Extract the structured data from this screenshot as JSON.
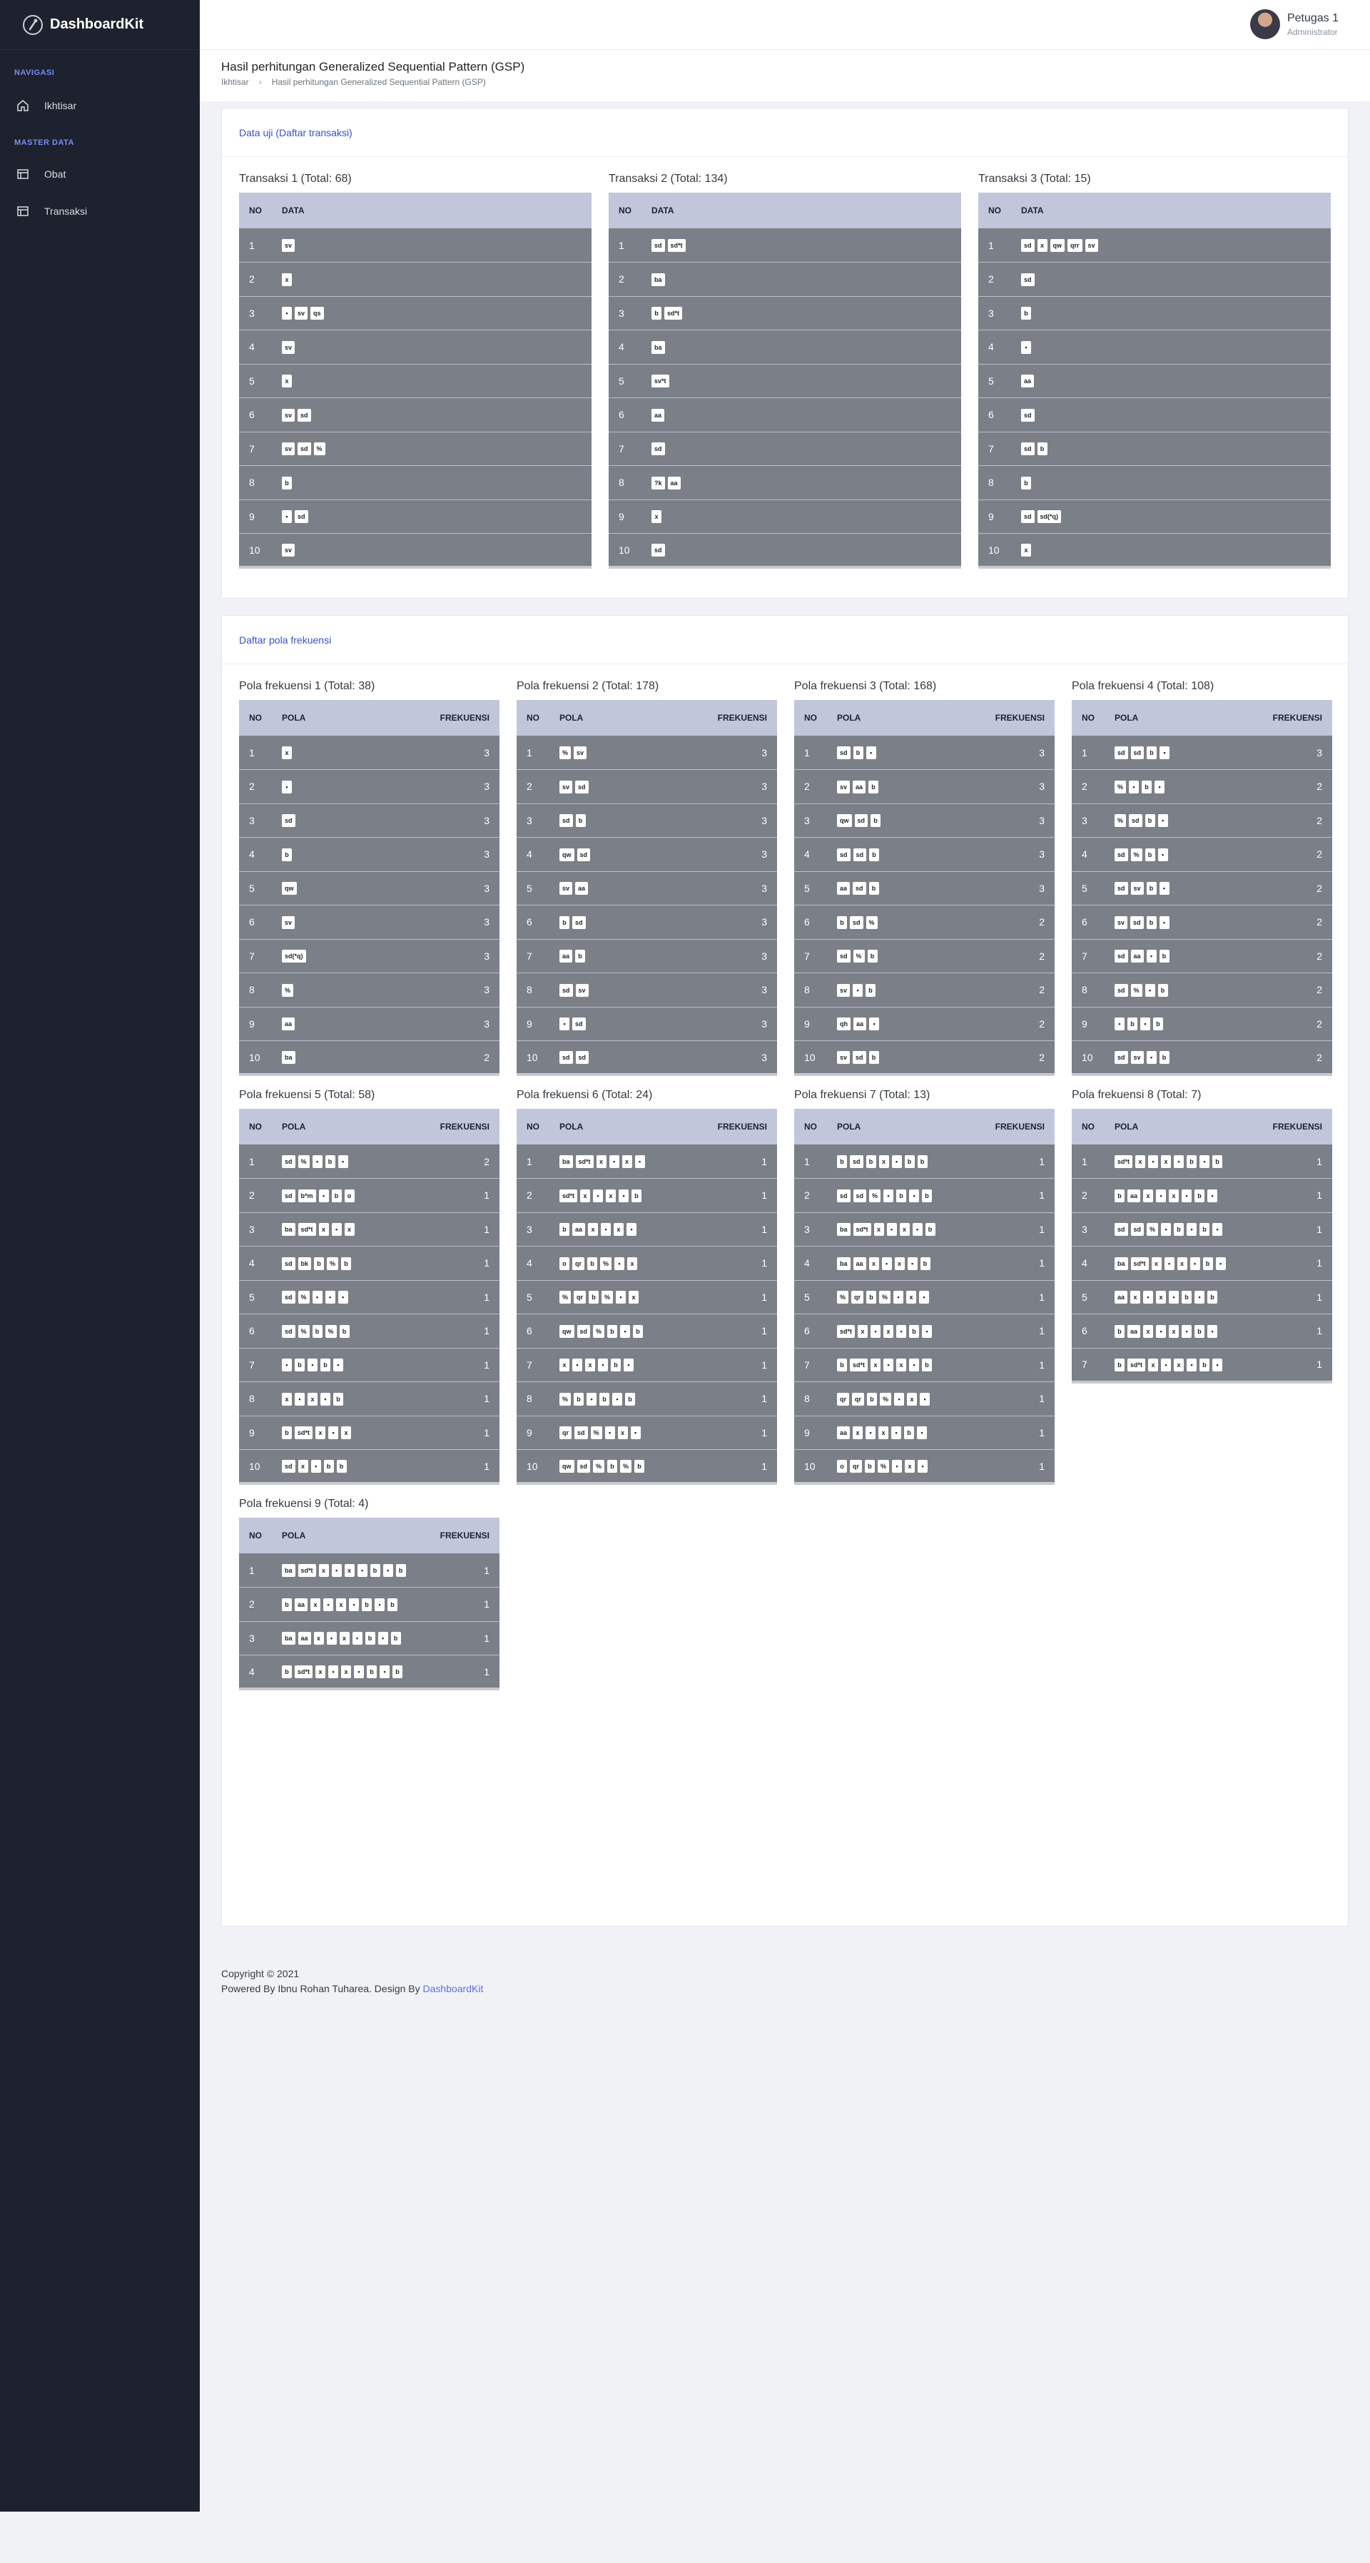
{
  "brand": "DashboardKit",
  "nav": {
    "heading1": "NAVIGASI",
    "ikhtisar": "Ikhtisar",
    "heading2": "MASTER DATA",
    "obat": "Obat",
    "transaksi": "Transaksi"
  },
  "user": {
    "name": "Petugas 1",
    "role": "Administrator"
  },
  "page": {
    "title": "Hasil perhitungan Generalized Sequential Pattern (GSP)",
    "crumb_home": "Ikhtisar",
    "crumb_current": "Hasil perhitungan Generalized Sequential Pattern (GSP)"
  },
  "card1": {
    "title": "Data uji (Daftar transaksi)",
    "col_no": "NO",
    "col_data": "DATA",
    "tables": [
      {
        "title": "Transaksi 1 (Total: 68)",
        "rows": [
          [
            "sv"
          ],
          [
            "x"
          ],
          [
            "•",
            "sv",
            "qs"
          ],
          [
            "sv"
          ],
          [
            "x"
          ],
          [
            "sv",
            "sd"
          ],
          [
            "sv",
            "sd",
            "%"
          ],
          [
            "b"
          ],
          [
            "•",
            "sd"
          ],
          [
            "sv"
          ]
        ]
      },
      {
        "title": "Transaksi 2 (Total: 134)",
        "rows": [
          [
            "sd",
            "sd*t"
          ],
          [
            "ba"
          ],
          [
            "b",
            "sd*t"
          ],
          [
            "ba"
          ],
          [
            "sv*t"
          ],
          [
            "aa"
          ],
          [
            "sd"
          ],
          [
            "?k",
            "aa"
          ],
          [
            "x"
          ],
          [
            "sd"
          ]
        ]
      },
      {
        "title": "Transaksi 3 (Total: 15)",
        "rows": [
          [
            "sd",
            "x",
            "qw",
            "qrr",
            "sv"
          ],
          [
            "sd"
          ],
          [
            "b"
          ],
          [
            "•"
          ],
          [
            "aa"
          ],
          [
            "sd"
          ],
          [
            "sd",
            "b"
          ],
          [
            "b"
          ],
          [
            "sd",
            "sd(*q)"
          ],
          [
            "x"
          ]
        ]
      }
    ]
  },
  "card2": {
    "title": "Daftar pola frekuensi",
    "col_no": "NO",
    "col_pola": "POLA",
    "col_freq": "FREKUENSI",
    "tables": [
      {
        "title": "Pola frekuensi 1 (Total: 38)",
        "rows": [
          {
            "p": [
              "x"
            ],
            "f": "3"
          },
          {
            "p": [
              "•"
            ],
            "f": "3"
          },
          {
            "p": [
              "sd"
            ],
            "f": "3"
          },
          {
            "p": [
              "b"
            ],
            "f": "3"
          },
          {
            "p": [
              "qw"
            ],
            "f": "3"
          },
          {
            "p": [
              "sv"
            ],
            "f": "3"
          },
          {
            "p": [
              "sd(*q)"
            ],
            "f": "3"
          },
          {
            "p": [
              "%"
            ],
            "f": "3"
          },
          {
            "p": [
              "aa"
            ],
            "f": "3"
          },
          {
            "p": [
              "ba"
            ],
            "f": "2"
          }
        ]
      },
      {
        "title": "Pola frekuensi 2 (Total: 178)",
        "rows": [
          {
            "p": [
              "%",
              "sv"
            ],
            "f": "3"
          },
          {
            "p": [
              "sv",
              "sd"
            ],
            "f": "3"
          },
          {
            "p": [
              "sd",
              "b"
            ],
            "f": "3"
          },
          {
            "p": [
              "qw",
              "sd"
            ],
            "f": "3"
          },
          {
            "p": [
              "sv",
              "aa"
            ],
            "f": "3"
          },
          {
            "p": [
              "b",
              "sd"
            ],
            "f": "3"
          },
          {
            "p": [
              "aa",
              "b"
            ],
            "f": "3"
          },
          {
            "p": [
              "sd",
              "sv"
            ],
            "f": "3"
          },
          {
            "p": [
              "•",
              "sd"
            ],
            "f": "3"
          },
          {
            "p": [
              "sd",
              "sd"
            ],
            "f": "3"
          }
        ]
      },
      {
        "title": "Pola frekuensi 3 (Total: 168)",
        "rows": [
          {
            "p": [
              "sd",
              "b",
              "•"
            ],
            "f": "3"
          },
          {
            "p": [
              "sv",
              "aa",
              "b"
            ],
            "f": "3"
          },
          {
            "p": [
              "qw",
              "sd",
              "b"
            ],
            "f": "3"
          },
          {
            "p": [
              "sd",
              "sd",
              "b"
            ],
            "f": "3"
          },
          {
            "p": [
              "aa",
              "sd",
              "b"
            ],
            "f": "3"
          },
          {
            "p": [
              "b",
              "sd",
              "%"
            ],
            "f": "2"
          },
          {
            "p": [
              "sd",
              "%",
              "b"
            ],
            "f": "2"
          },
          {
            "p": [
              "sv",
              "•",
              "b"
            ],
            "f": "2"
          },
          {
            "p": [
              "qh",
              "aa",
              "•"
            ],
            "f": "2"
          },
          {
            "p": [
              "sv",
              "sd",
              "b"
            ],
            "f": "2"
          }
        ]
      },
      {
        "title": "Pola frekuensi 4 (Total: 108)",
        "rows": [
          {
            "p": [
              "sd",
              "sd",
              "b",
              "•"
            ],
            "f": "3"
          },
          {
            "p": [
              "%",
              "•",
              "b",
              "•"
            ],
            "f": "2"
          },
          {
            "p": [
              "%",
              "sd",
              "b",
              "•"
            ],
            "f": "2"
          },
          {
            "p": [
              "sd",
              "%",
              "b",
              "•"
            ],
            "f": "2"
          },
          {
            "p": [
              "sd",
              "sv",
              "b",
              "•"
            ],
            "f": "2"
          },
          {
            "p": [
              "sv",
              "sd",
              "b",
              "•"
            ],
            "f": "2"
          },
          {
            "p": [
              "sd",
              "aa",
              "•",
              "b"
            ],
            "f": "2"
          },
          {
            "p": [
              "sd",
              "%",
              "•",
              "b"
            ],
            "f": "2"
          },
          {
            "p": [
              "•",
              "b",
              "•",
              "b"
            ],
            "f": "2"
          },
          {
            "p": [
              "sd",
              "sv",
              "•",
              "b"
            ],
            "f": "2"
          }
        ]
      },
      {
        "title": "Pola frekuensi 5 (Total: 58)",
        "rows": [
          {
            "p": [
              "sd",
              "%",
              "•",
              "b",
              "•"
            ],
            "f": "2"
          },
          {
            "p": [
              "sd",
              "b*m",
              "•",
              "b",
              "o"
            ],
            "f": "1"
          },
          {
            "p": [
              "ba",
              "sd*t",
              "x",
              "•",
              "x"
            ],
            "f": "1"
          },
          {
            "p": [
              "sd",
              "bk",
              "b",
              "%",
              "b"
            ],
            "f": "1"
          },
          {
            "p": [
              "sd",
              "%",
              "•",
              "•",
              "•"
            ],
            "f": "1"
          },
          {
            "p": [
              "sd",
              "%",
              "b",
              "%",
              "b"
            ],
            "f": "1"
          },
          {
            "p": [
              "•",
              "b",
              "•",
              "b",
              "•"
            ],
            "f": "1"
          },
          {
            "p": [
              "x",
              "•",
              "x",
              "•",
              "b"
            ],
            "f": "1"
          },
          {
            "p": [
              "b",
              "sd*t",
              "x",
              "•",
              "x"
            ],
            "f": "1"
          },
          {
            "p": [
              "sd",
              "x",
              "•",
              "b",
              "b"
            ],
            "f": "1"
          }
        ]
      },
      {
        "title": "Pola frekuensi 6 (Total: 24)",
        "rows": [
          {
            "p": [
              "ba",
              "sd*t",
              "x",
              "•",
              "x",
              "•"
            ],
            "f": "1"
          },
          {
            "p": [
              "sd*t",
              "x",
              "•",
              "x",
              "•",
              "b"
            ],
            "f": "1"
          },
          {
            "p": [
              "b",
              "aa",
              "x",
              "•",
              "x",
              "•"
            ],
            "f": "1"
          },
          {
            "p": [
              "o",
              "qr",
              "b",
              "%",
              "•",
              "x"
            ],
            "f": "1"
          },
          {
            "p": [
              "%",
              "qr",
              "b",
              "%",
              "•",
              "x"
            ],
            "f": "1"
          },
          {
            "p": [
              "qw",
              "sd",
              "%",
              "b",
              "•",
              "b"
            ],
            "f": "1"
          },
          {
            "p": [
              "x",
              "•",
              "x",
              "•",
              "b",
              "•"
            ],
            "f": "1"
          },
          {
            "p": [
              "%",
              "b",
              "•",
              "b",
              "•",
              "b"
            ],
            "f": "1"
          },
          {
            "p": [
              "qr",
              "sd",
              "%",
              "•",
              "x",
              "•"
            ],
            "f": "1"
          },
          {
            "p": [
              "qw",
              "sd",
              "%",
              "b",
              "%",
              "b"
            ],
            "f": "1"
          }
        ]
      },
      {
        "title": "Pola frekuensi 7 (Total: 13)",
        "rows": [
          {
            "p": [
              "b",
              "sd",
              "b",
              "x",
              "•",
              "b",
              "b"
            ],
            "f": "1"
          },
          {
            "p": [
              "sd",
              "sd",
              "%",
              "•",
              "b",
              "•",
              "b"
            ],
            "f": "1"
          },
          {
            "p": [
              "ba",
              "sd*t",
              "x",
              "•",
              "x",
              "•",
              "b"
            ],
            "f": "1"
          },
          {
            "p": [
              "ba",
              "aa",
              "x",
              "•",
              "x",
              "•",
              "b"
            ],
            "f": "1"
          },
          {
            "p": [
              "%",
              "qr",
              "b",
              "%",
              "•",
              "x",
              "•"
            ],
            "f": "1"
          },
          {
            "p": [
              "sd*t",
              "x",
              "•",
              "x",
              "•",
              "b",
              "•"
            ],
            "f": "1"
          },
          {
            "p": [
              "b",
              "sd*t",
              "x",
              "•",
              "x",
              "•",
              "b"
            ],
            "f": "1"
          },
          {
            "p": [
              "qr",
              "qr",
              "b",
              "%",
              "•",
              "x",
              "•"
            ],
            "f": "1"
          },
          {
            "p": [
              "aa",
              "x",
              "•",
              "x",
              "•",
              "b",
              "•"
            ],
            "f": "1"
          },
          {
            "p": [
              "o",
              "qr",
              "b",
              "%",
              "•",
              "x",
              "•"
            ],
            "f": "1"
          }
        ]
      },
      {
        "title": "Pola frekuensi 8 (Total: 7)",
        "rows": [
          {
            "p": [
              "sd*t",
              "x",
              "•",
              "x",
              "•",
              "b",
              "•",
              "b"
            ],
            "f": "1"
          },
          {
            "p": [
              "b",
              "aa",
              "x",
              "•",
              "x",
              "•",
              "b",
              "•"
            ],
            "f": "1"
          },
          {
            "p": [
              "sd",
              "sd",
              "%",
              "•",
              "b",
              "•",
              "b",
              "•"
            ],
            "f": "1"
          },
          {
            "p": [
              "ba",
              "sd*t",
              "x",
              "•",
              "x",
              "•",
              "b",
              "•"
            ],
            "f": "1"
          },
          {
            "p": [
              "aa",
              "x",
              "•",
              "x",
              "•",
              "b",
              "•",
              "b"
            ],
            "f": "1"
          },
          {
            "p": [
              "b",
              "aa",
              "x",
              "•",
              "x",
              "•",
              "b",
              "•"
            ],
            "f": "1"
          },
          {
            "p": [
              "b",
              "sd*t",
              "x",
              "•",
              "x",
              "•",
              "b",
              "•"
            ],
            "f": "1"
          }
        ]
      },
      {
        "title": "Pola frekuensi 9 (Total: 4)",
        "rows": [
          {
            "p": [
              "ba",
              "sd*t",
              "x",
              "•",
              "x",
              "•",
              "b",
              "•",
              "b"
            ],
            "f": "1"
          },
          {
            "p": [
              "b",
              "aa",
              "x",
              "•",
              "x",
              "•",
              "b",
              "•",
              "b"
            ],
            "f": "1"
          },
          {
            "p": [
              "ba",
              "aa",
              "x",
              "•",
              "x",
              "•",
              "b",
              "•",
              "b"
            ],
            "f": "1"
          },
          {
            "p": [
              "b",
              "sd*t",
              "x",
              "•",
              "x",
              "•",
              "b",
              "•",
              "b"
            ],
            "f": "1"
          }
        ]
      }
    ]
  },
  "footer": {
    "copyright": "Copyright © 2021",
    "powered": "Powered By Ibnu Rohan Tuharea. Design By ",
    "link": "DashboardKit"
  }
}
